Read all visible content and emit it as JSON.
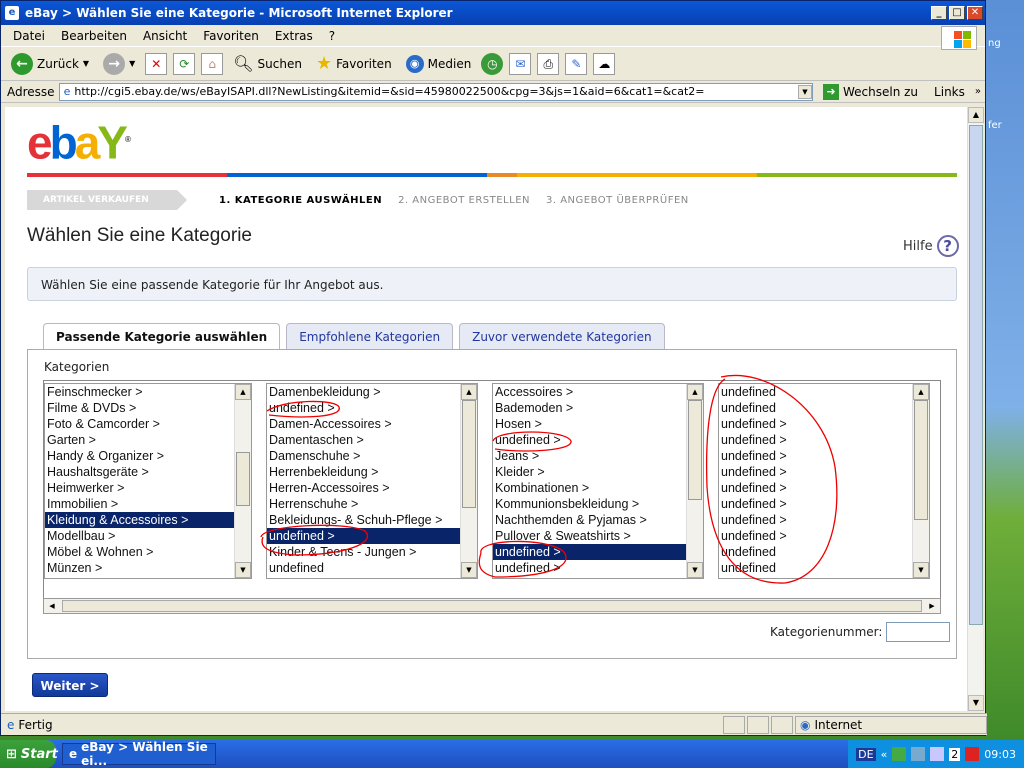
{
  "window": {
    "title": "eBay > Wählen Sie eine Kategorie - Microsoft Internet Explorer",
    "controls": [
      "_",
      "□",
      "✕"
    ]
  },
  "menu": [
    "Datei",
    "Bearbeiten",
    "Ansicht",
    "Favoriten",
    "Extras",
    "?"
  ],
  "toolbar": {
    "back": "Zurück",
    "search": "Suchen",
    "favorites": "Favoriten",
    "media": "Medien"
  },
  "address": {
    "label": "Adresse",
    "url": "http://cgi5.ebay.de/ws/eBayISAPI.dll?NewListing&itemid=&sid=45980022500&cpg=3&js=1&aid=6&cat1=&cat2=",
    "go": "Wechseln zu",
    "links": "Links"
  },
  "desktop": {
    "label1": "ng",
    "label2": "fer"
  },
  "page": {
    "steps": {
      "main": "ARTIKEL VERKAUFEN",
      "s1": "1. KATEGORIE AUSWÄHLEN",
      "s2": "2. ANGEBOT ERSTELLEN",
      "s3": "3. ANGEBOT ÜBERPRÜFEN"
    },
    "heading": "Wählen Sie eine Kategorie",
    "help": "Hilfe",
    "info": "Wählen Sie eine passende Kategorie für Ihr Angebot aus.",
    "tabs": [
      "Passende Kategorie auswählen",
      "Empfohlene Kategorien",
      "Zuvor verwendete Kategorien"
    ],
    "kategorien_label": "Kategorien",
    "columns": [
      {
        "items": [
          "Feinschmecker >",
          "Filme & DVDs >",
          "Foto & Camcorder >",
          "Garten >",
          "Handy & Organizer >",
          "Haushaltsgeräte >",
          "Heimwerker >",
          "Immobilien >",
          "Kleidung & Accessoires >",
          "Modellbau >",
          "Möbel & Wohnen >",
          "Münzen >"
        ],
        "selected": 8
      },
      {
        "items": [
          "Damenbekleidung >",
          "undefined >",
          "Damen-Accessoires >",
          "Damentaschen >",
          "Damenschuhe >",
          "Herrenbekleidung >",
          "Herren-Accessoires >",
          "Herrenschuhe >",
          "Bekleidungs- & Schuh-Pflege >",
          "undefined >",
          "Kinder & Teens - Jungen >",
          "undefined"
        ],
        "selected": 9
      },
      {
        "items": [
          "Accessoires >",
          "Bademoden >",
          "Hosen >",
          "undefined >",
          "Jeans >",
          "Kleider >",
          "Kombinationen >",
          "Kommunionsbekleidung >",
          "Nachthemden & Pyjamas >",
          "Pullover & Sweatshirts >",
          "undefined >",
          "undefined >"
        ],
        "selected": 10
      },
      {
        "items": [
          "undefined",
          "undefined",
          "undefined >",
          "undefined >",
          "undefined >",
          "undefined >",
          "undefined >",
          "undefined >",
          "undefined >",
          "undefined >",
          "undefined",
          "undefined"
        ],
        "selected": -1
      }
    ],
    "katnum_label": "Kategorienummer:",
    "weiter": "Weiter >"
  },
  "status": {
    "text": "Fertig",
    "zone": "Internet"
  },
  "taskbar": {
    "start": "Start",
    "task": "eBay > Wählen Sie ei...",
    "lang": "DE",
    "num": "2",
    "time": "09:03"
  },
  "logo": {
    "text": [
      "e",
      "b",
      "a",
      "Y"
    ],
    "colors": [
      "#e53238",
      "#0064d2",
      "#f5af02",
      "#86b817"
    ]
  },
  "colorbar_colors": [
    "#e53238",
    "#0064d2",
    "#f5af02",
    "#86b817"
  ]
}
